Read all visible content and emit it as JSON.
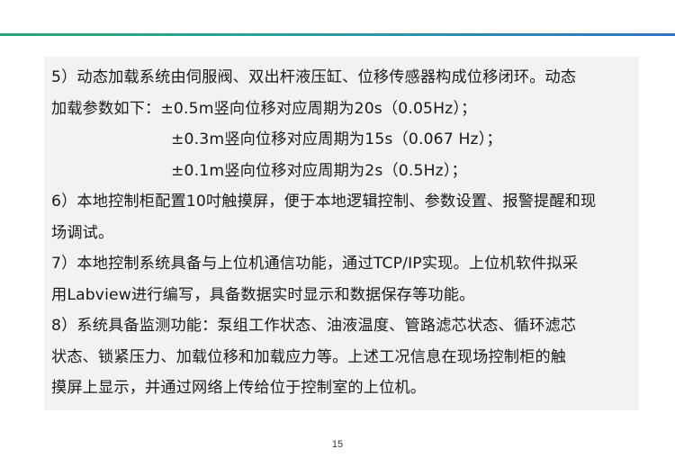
{
  "lines": [
    "5）动态加载系统由伺服阀、双出杆液压缸、位移传感器构成位移闭环。动态",
    "加载参数如下：±0.5m竖向位移对应周期为20s（0.05Hz）；",
    "±0.3m竖向位移对应周期为15s（0.067 Hz）；",
    "±0.1m竖向位移对应周期为2s（0.5Hz）；",
    "6）本地控制柜配置10吋触摸屏，便于本地逻辑控制、参数设置、报警提醒和现",
    "场调试。",
    "7）本地控制系统具备与上位机通信功能，通过TCP/IP实现。上位机软件拟采",
    "用Labview进行编写，具备数据实时显示和数据保存等功能。",
    "8）系统具备监测功能：泵组工作状态、油液温度、管路滤芯状态、循环滤芯",
    "状态、锁紧压力、加载位移和加载应力等。上述工况信息在现场控制柜的触",
    "摸屏上显示，并通过网络上传给位于控制室的上位机。"
  ],
  "page_number": "15",
  "colors": {
    "rule_start": "#2aa876",
    "rule_end": "#2f74c8",
    "box_background": "#f2f2f2"
  }
}
